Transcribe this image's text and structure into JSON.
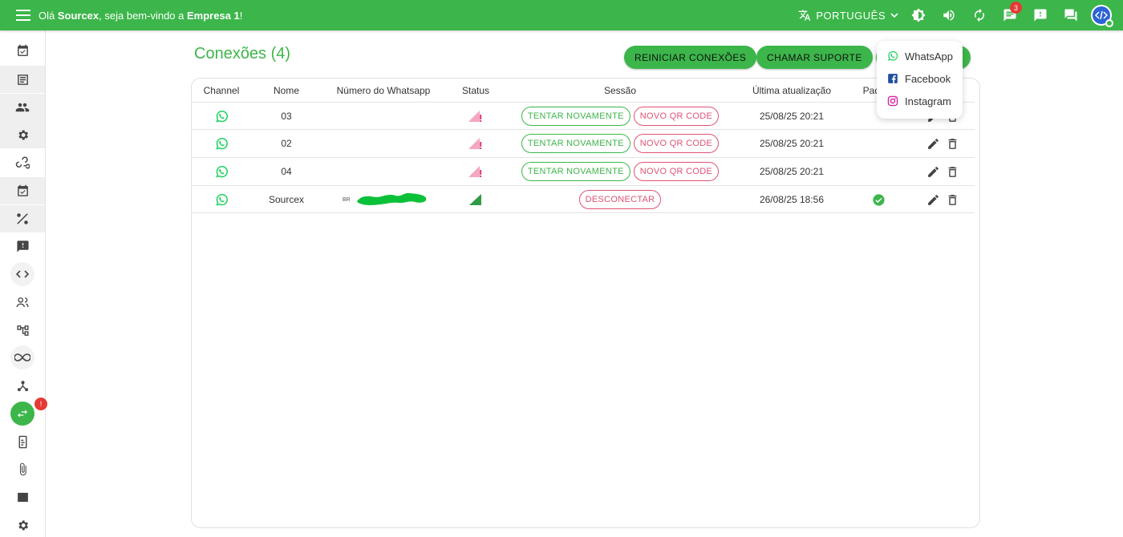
{
  "header": {
    "greeting_prefix": "Olá ",
    "user_name": "Sourcex",
    "greeting_middle": ", seja bem-vindo a ",
    "company": "Empresa 1",
    "greeting_suffix": "!",
    "language": "PORTUGUÊS",
    "notification_count": "3",
    "bar_color": "#3cb64a"
  },
  "sidebar": {
    "items": [
      {
        "icon": "event-available-icon"
      },
      {
        "icon": "list-icon"
      },
      {
        "icon": "people-icon"
      },
      {
        "icon": "settings-icon"
      },
      {
        "icon": "webhook-icon"
      },
      {
        "icon": "event-available-icon"
      },
      {
        "icon": "tools-icon"
      },
      {
        "icon": "feedback-icon"
      },
      {
        "icon": "code-icon"
      },
      {
        "icon": "contacts-icon"
      },
      {
        "icon": "account-tree-icon"
      },
      {
        "icon": "infinity-icon"
      },
      {
        "icon": "hub-icon"
      },
      {
        "icon": "swap-horizontal-icon",
        "active": true,
        "badge": "!"
      },
      {
        "icon": "mobile-transfer-icon"
      },
      {
        "icon": "attach-file-icon"
      },
      {
        "icon": "money-icon"
      },
      {
        "icon": "settings-icon"
      }
    ]
  },
  "main": {
    "title": "Conexões (4)",
    "buttons": {
      "restart": "REINICIAR CONEXÕES",
      "support": "CHAMAR SUPORTE"
    }
  },
  "table": {
    "columns": [
      "Channel",
      "Nome",
      "Número do Whatsapp",
      "Status",
      "Sessão",
      "Última atualização",
      "Padrão"
    ],
    "rows": [
      {
        "channel": "whatsapp-icon",
        "name": "03",
        "number": "",
        "status": "signal-error",
        "session": [
          "TENTAR NOVAMENTE",
          "NOVO QR CODE"
        ],
        "updated": "25/08/25 20:21",
        "default": false
      },
      {
        "channel": "whatsapp-icon",
        "name": "02",
        "number": "",
        "status": "signal-error",
        "session": [
          "TENTAR NOVAMENTE",
          "NOVO QR CODE"
        ],
        "updated": "25/08/25 20:21",
        "default": false
      },
      {
        "channel": "whatsapp-icon",
        "name": "04",
        "number": "",
        "status": "signal-error",
        "session": [
          "TENTAR NOVAMENTE",
          "NOVO QR CODE"
        ],
        "updated": "25/08/25 20:21",
        "default": false
      },
      {
        "channel": "whatsapp-icon",
        "name": "Sourcex",
        "number": "BR",
        "status": "signal-connected",
        "session": [
          "DESCONECTAR"
        ],
        "updated": "26/08/25 18:56",
        "default": true
      }
    ]
  },
  "dropdown": {
    "items": [
      {
        "label": "WhatsApp",
        "icon": "whatsapp-icon",
        "color": "#25d366"
      },
      {
        "label": "Facebook",
        "icon": "facebook-icon",
        "color": "#1f4e9e"
      },
      {
        "label": "Instagram",
        "icon": "instagram-icon",
        "color": "#d6249f"
      }
    ]
  }
}
